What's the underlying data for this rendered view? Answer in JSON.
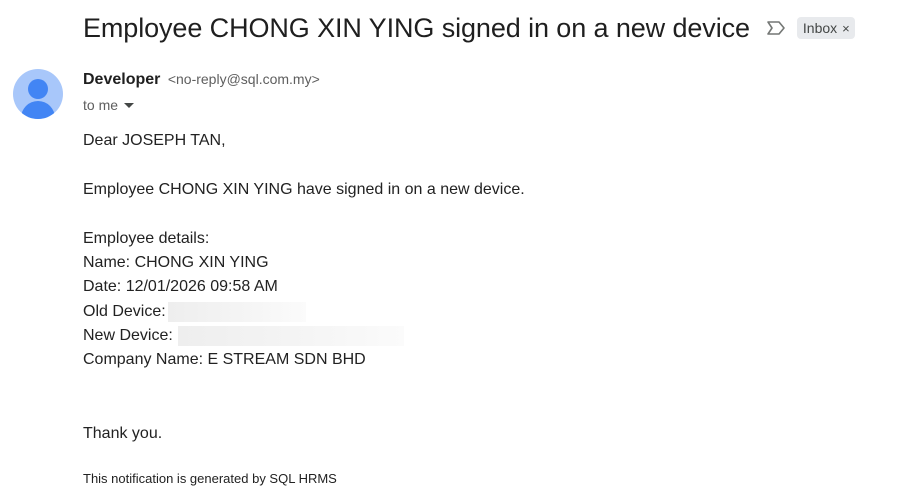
{
  "header": {
    "subject": "Employee CHONG XIN YING signed in on a new device",
    "importance_icon": "importance-marker-icon",
    "label": "Inbox",
    "label_close": "×"
  },
  "sender": {
    "avatar_icon": "person-avatar-icon",
    "name": "Developer",
    "email": "<no-reply@sql.com.my>",
    "to_text": "to me",
    "to_caret_icon": "caret-down-icon"
  },
  "body": {
    "greeting": "Dear JOSEPH TAN,",
    "intro": "Employee CHONG XIN YING have signed in on a new device.",
    "details_heading": "Employee details:",
    "name_line": "Name: CHONG XIN YING",
    "date_line": "Date: 12/01/2026 09:58 AM",
    "old_device_label": "Old Device:",
    "new_device_label": "New Device:",
    "company_line": "Company Name: E STREAM SDN BHD",
    "closing": "Thank you.",
    "footer": "This notification is generated by SQL HRMS"
  },
  "colors": {
    "avatar_bg": "#a8c7fa",
    "avatar_fg": "#4285f4",
    "label_chip_bg": "#e8eaed"
  }
}
